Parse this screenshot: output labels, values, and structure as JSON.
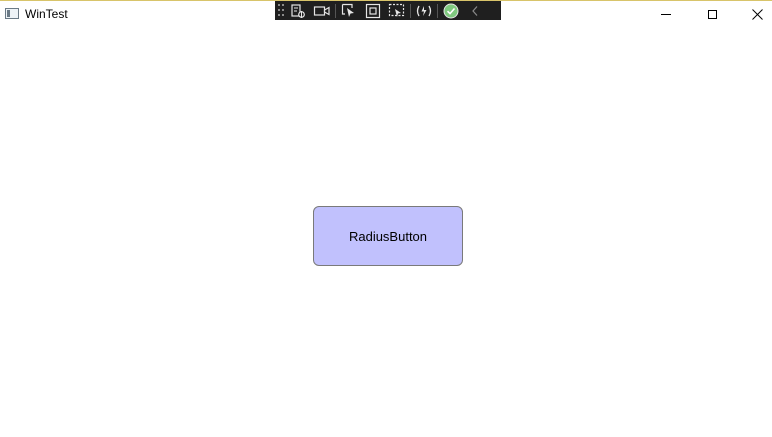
{
  "window": {
    "title": "WinTest"
  },
  "main": {
    "radius_button_label": "RadiusButton"
  },
  "colors": {
    "button_fill": "#c1c1fd",
    "button_border": "#7a7a7a",
    "toolbar_bg": "#1f1f1f",
    "check_green": "#7fc97f"
  },
  "debug_toolbar": {
    "icons": [
      "live-visual-tree-icon",
      "video-capture-icon",
      "select-element-icon",
      "display-layout-adorners-icon",
      "track-focus-icon",
      "hot-reload-icon",
      "binding-failures-check-icon",
      "collapse-chevron-icon"
    ]
  }
}
